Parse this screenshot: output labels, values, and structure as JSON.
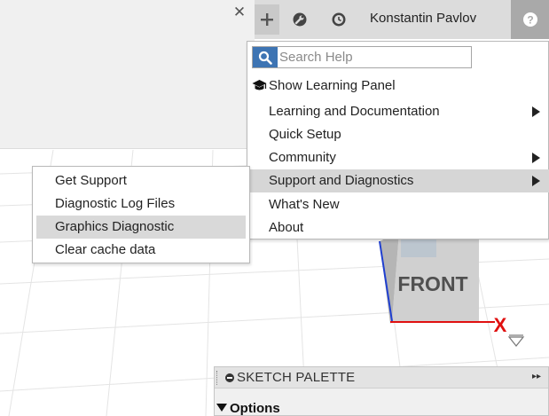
{
  "user": {
    "name": "Konstantin Pavlov"
  },
  "search": {
    "placeholder": "Search Help"
  },
  "help_menu": {
    "items": [
      {
        "label": "Show Learning Panel"
      },
      {
        "label": "Learning and Documentation"
      },
      {
        "label": "Quick Setup"
      },
      {
        "label": "Community"
      },
      {
        "label": "Support and Diagnostics"
      },
      {
        "label": "What's New"
      },
      {
        "label": "About"
      }
    ]
  },
  "support_submenu": {
    "items": [
      {
        "label": "Get Support"
      },
      {
        "label": "Diagnostic Log Files"
      },
      {
        "label": "Graphics Diagnostic"
      },
      {
        "label": "Clear cache data"
      }
    ]
  },
  "viewcube": {
    "face_label": "FRONT",
    "axis_label": "X"
  },
  "sketch_palette": {
    "title": "SKETCH PALETTE",
    "section": "Options"
  },
  "colors": {
    "search_button": "#3d74b3",
    "axis_x": "#e01010",
    "axis_z": "#1f3fd0",
    "menu_highlight": "#d6d6d6",
    "help_button": "#a9a9a9"
  }
}
